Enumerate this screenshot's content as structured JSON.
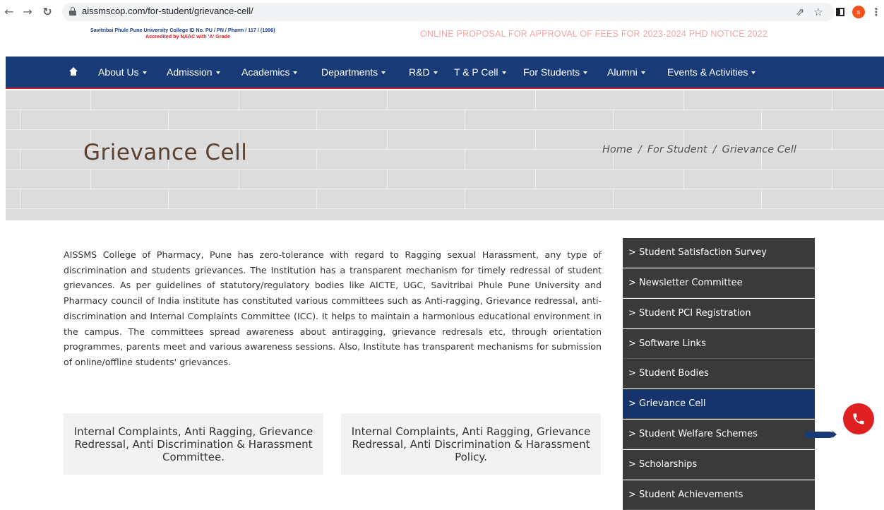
{
  "browser": {
    "url": "aissmscop.com/for-student/grievance-cell/",
    "back_icon": "arrow-left-icon",
    "forward_icon": "arrow-right-icon",
    "reload_icon": "reload-icon",
    "avatar_letter": "s"
  },
  "topbar": {
    "university_line": "Savitribai Phule Pune University College ID No. PU / PN / Pharm / 117 / (1996)",
    "accreditation_line": "Accredited by NAAC with 'A' Grade",
    "marquee": "ONLINE PROPOSAL FOR APPROVAL OF FEES FOR 2023-2024   PHD NOTICE 2022"
  },
  "nav": {
    "items": [
      {
        "label": "About Us"
      },
      {
        "label": "Admission"
      },
      {
        "label": "Academics"
      },
      {
        "label": "Departments"
      },
      {
        "label": "R&D"
      },
      {
        "label": "T & P Cell"
      },
      {
        "label": "For Students"
      },
      {
        "label": "Alumni"
      },
      {
        "label": "Events & Activities"
      }
    ]
  },
  "banner": {
    "title": "Grievance Cell",
    "breadcrumb": [
      "Home",
      "For Student",
      "Grievance Cell"
    ]
  },
  "main": {
    "description": "AISSMS College of Pharmacy, Pune has  zero-tolerance with regard to Ragging sexual Harassment, any type of discrimination and students grievances. The Institution has a transparent mechanism for timely redressal of student grievances. As per guidelines of statutory/regulatory bodies like AICTE, UGC, Savitribai Phule Pune University and Pharmacy council of India institute has constituted various committees such as Anti-ragging, Grievance redressal, anti-discrimination and Internal Complaints Committee (ICC). It helps to maintain a harmonious educational environment in the campus. The committees spread awareness about antiragging, grievance redresals etc, through orientation programmes, parents meet and various awareness sessions. Also, Institute has transparent mechanisms for submission of online/offline students' grievances.",
    "cards": [
      {
        "label": "Internal Complaints, Anti Ragging, Grievance Redressal, Anti Discrimination & Harassment Committee."
      },
      {
        "label": "Internal Complaints, Anti Ragging, Grievance Redressal, Anti Discrimination & Harassment Policy."
      }
    ]
  },
  "sidebar": {
    "items": [
      {
        "label": "> Student Satisfaction Survey"
      },
      {
        "label": "> Newsletter Committee"
      },
      {
        "label": "> Student PCI Registration"
      },
      {
        "label": "> Software Links"
      },
      {
        "label": "> Student Bodies"
      },
      {
        "label": "> Grievance Cell"
      },
      {
        "label": "> Student Welfare Schemes"
      },
      {
        "label": "> Scholarships"
      },
      {
        "label": "> Student Achievements"
      }
    ],
    "active_index": 5
  },
  "colors": {
    "nav_bg": "#183b77",
    "sidebar_bg": "#3a3a3a",
    "sidebar_active": "#16346b",
    "call_button": "#e02020"
  }
}
